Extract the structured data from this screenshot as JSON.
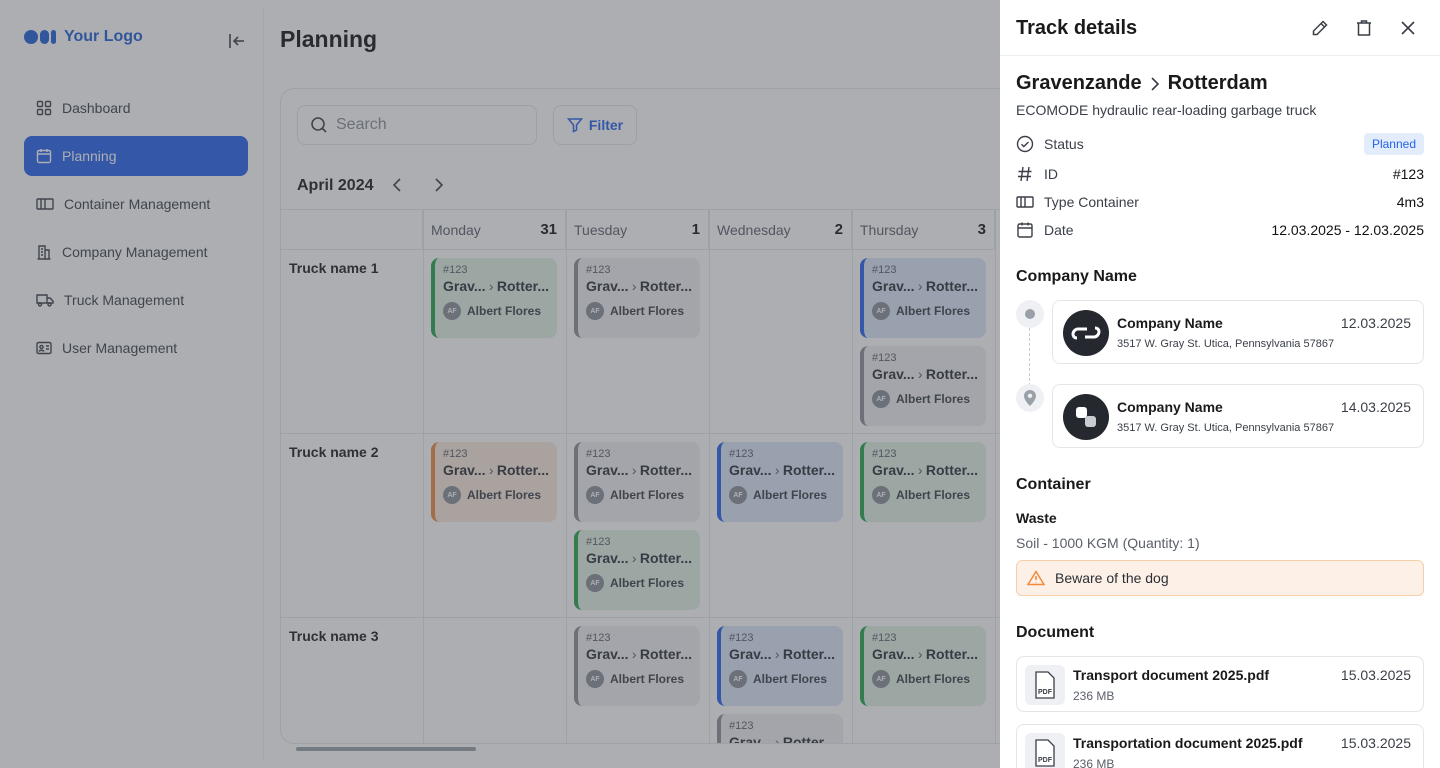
{
  "sidebar": {
    "logo_text": "Your Logo",
    "items": [
      {
        "label": "Dashboard"
      },
      {
        "label": "Planning"
      },
      {
        "label": "Container Management"
      },
      {
        "label": "Company Management"
      },
      {
        "label": "Truck Management"
      },
      {
        "label": "User Management"
      }
    ]
  },
  "main": {
    "title": "Planning",
    "search_placeholder": "Search",
    "filter_label": "Filter",
    "month": "April 2024",
    "days": [
      {
        "name": "Monday",
        "num": "31"
      },
      {
        "name": "Tuesday",
        "num": "1"
      },
      {
        "name": "Wednesday",
        "num": "2"
      },
      {
        "name": "Thursday",
        "num": "3"
      }
    ],
    "trucks": [
      "Truck name 1",
      "Truck name 2",
      "Truck name 3"
    ],
    "card": {
      "id": "#123",
      "from": "Grav...",
      "to": "Rotter...",
      "initials": "AF",
      "driver": "Albert Flores"
    }
  },
  "drawer": {
    "title": "Track details",
    "from": "Gravenzande",
    "to": "Rotterdam",
    "truck": "ECOMODE hydraulic rear-loading garbage truck",
    "status_label": "Status",
    "status_value": "Planned",
    "id_label": "ID",
    "id_value": "#123",
    "type_label": "Type Container",
    "type_value": "4m3",
    "date_label": "Date",
    "date_value": "12.03.2025 - 12.03.2025",
    "company_section": "Company Name",
    "companies": [
      {
        "name": "Company Name",
        "date": "12.03.2025",
        "address": "3517 W. Gray St. Utica, Pennsylvania 57867"
      },
      {
        "name": "Company Name",
        "date": "14.03.2025",
        "address": "3517 W. Gray St. Utica, Pennsylvania 57867"
      }
    ],
    "container_section": "Container",
    "waste_label": "Waste",
    "waste_value": "Soil - 1000 KGM (Quantity: 1)",
    "warning": "Beware of the dog",
    "document_section": "Document",
    "documents": [
      {
        "name": "Transport document 2025.pdf",
        "size": "236 MB",
        "date": "15.03.2025"
      },
      {
        "name": "Transportation document 2025.pdf",
        "size": "236 MB",
        "date": "15.03.2025"
      }
    ],
    "pdf_label": "PDF"
  },
  "colors": {
    "accent": "#2563eb",
    "green": "#22a447",
    "orange": "#ef8a3c",
    "gray": "#8a8f98",
    "warning_bg": "#fdf0e6"
  }
}
